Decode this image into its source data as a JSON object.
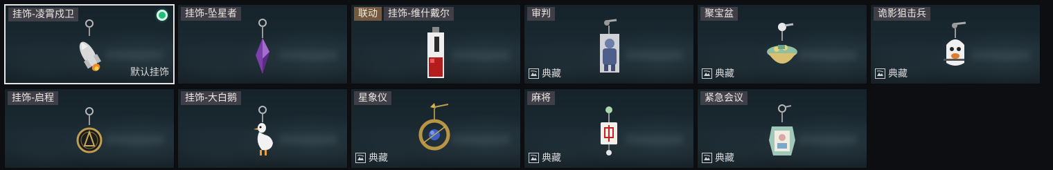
{
  "charms": [
    {
      "name": "挂饰-凌霄戍卫",
      "selected": true,
      "default_label": "默认挂饰",
      "icon": "rocket-charm-icon"
    },
    {
      "name": "挂饰-坠星者",
      "icon": "crystal-charm-icon"
    },
    {
      "collab_tag": "联动",
      "name": "挂饰-维什戴尔",
      "icon": "card-charm-icon"
    },
    {
      "name": "审判",
      "rarity": "典藏",
      "icon": "figure-card-charm-icon"
    },
    {
      "name": "聚宝盆",
      "rarity": "典藏",
      "icon": "treasure-bowl-charm-icon"
    },
    {
      "name": "诡影狙击兵",
      "rarity": "典藏",
      "icon": "ghost-sniper-charm-icon"
    },
    {
      "name": "挂饰-启程",
      "icon": "compass-ring-charm-icon"
    },
    {
      "name": "挂饰-大白鹅",
      "icon": "goose-charm-icon"
    },
    {
      "name": "星象仪",
      "rarity": "典藏",
      "icon": "astrolabe-charm-icon"
    },
    {
      "name": "麻将",
      "rarity": "典藏",
      "icon": "mahjong-tile-charm-icon"
    },
    {
      "name": "紧急会议",
      "rarity": "典藏",
      "icon": "emergency-meeting-charm-icon"
    }
  ],
  "colors": {
    "selected_dot": "#1fbf78",
    "tag_bg": "#4b4650",
    "collab_tag_bg": "#7d5f41"
  }
}
